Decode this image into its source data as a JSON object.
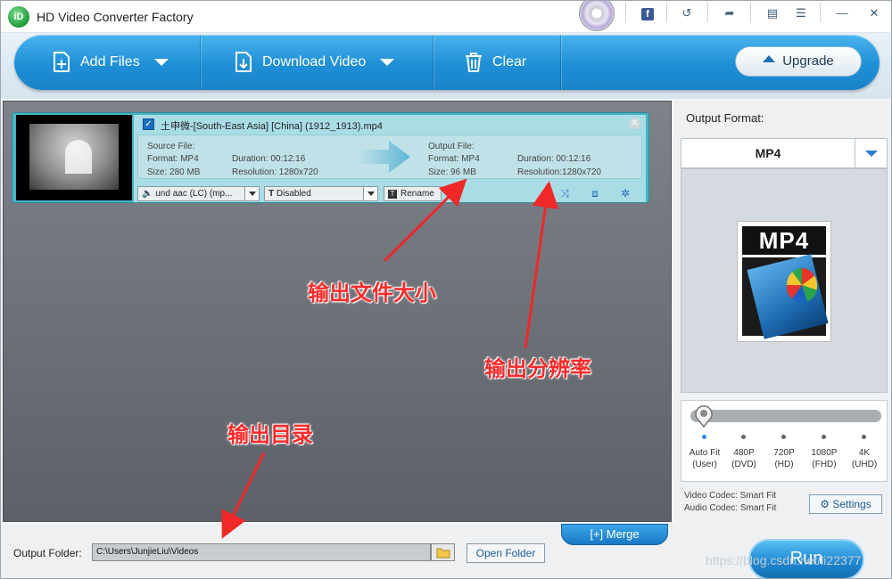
{
  "app": {
    "title": "HD Video Converter Factory",
    "logo_text": "iD"
  },
  "titlebar_icons": [
    "disc-icon",
    "facebook-icon",
    "refresh-icon",
    "share-icon",
    "chat-icon",
    "list-icon",
    "minimize-icon",
    "close-icon"
  ],
  "toolbar": {
    "add_files": "Add Files",
    "download_video": "Download Video",
    "clear": "Clear",
    "upgrade": "Upgrade"
  },
  "task": {
    "filename": "土申微-[South-East Asia] [China] (1912_1913).mp4",
    "source_label": "Source File:",
    "source_format": "Format: MP4",
    "source_duration": "Duration: 00:12:16",
    "source_size": "Size: 280 MB",
    "source_resolution": "Resolution: 1280x720",
    "output_label": "Output File:",
    "output_format": "Format: MP4",
    "output_duration": "Duration: 00:12:16",
    "output_size": "Size: 96 MB",
    "output_resolution": "Resolution:1280x720",
    "audio_track": "und aac (LC) (mp...",
    "subtitle": "Disabled",
    "rename": "Rename"
  },
  "annotations": {
    "size": "输出文件大小",
    "resolution": "输出分辨率",
    "directory": "输出目录"
  },
  "right_panel": {
    "output_format_label": "Output Format:",
    "format": "MP4",
    "preview_text": "MP4",
    "quality_levels": [
      {
        "l1": "Auto Fit",
        "l2": "(User)"
      },
      {
        "l1": "480P",
        "l2": "(DVD)"
      },
      {
        "l1": "720P",
        "l2": "(HD)"
      },
      {
        "l1": "1080P",
        "l2": "(FHD)"
      },
      {
        "l1": "4K",
        "l2": "(UHD)"
      }
    ],
    "video_codec": "Video Codec: Smart Fit",
    "audio_codec": "Audio Codec: Smart Fit",
    "settings": "Settings"
  },
  "bottom": {
    "merge": "Merge",
    "output_folder_label": "Output Folder:",
    "output_path": "C:\\Users\\JunjieLiu\\Videos",
    "open_folder": "Open Folder",
    "run": "Run"
  },
  "watermark": "https://blog.csdn.net/li22377"
}
